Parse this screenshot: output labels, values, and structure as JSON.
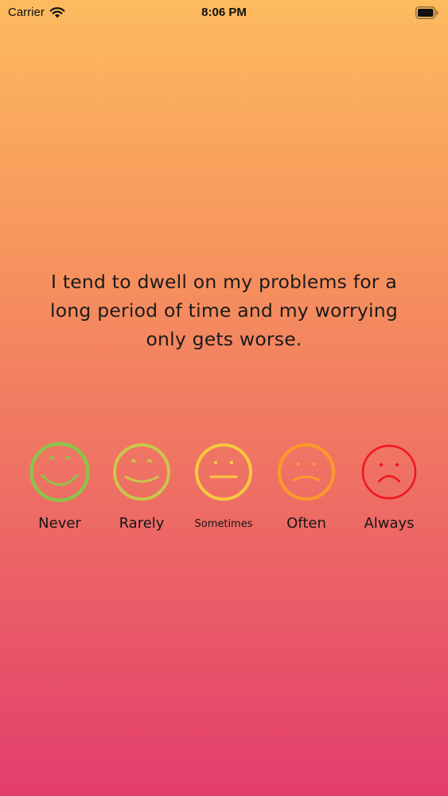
{
  "status_bar": {
    "carrier": "Carrier",
    "time": "8:06 PM",
    "wifi_icon": "wifi-icon",
    "battery_icon": "battery-icon"
  },
  "question": {
    "text": "I tend to dwell on my problems for a long period of time and my worrying only gets worse."
  },
  "options": [
    {
      "label": "Never",
      "icon": "big-smile-face-icon",
      "color": "#8cc34a"
    },
    {
      "label": "Rarely",
      "icon": "smile-face-icon",
      "color": "#c9c64a"
    },
    {
      "label": "Sometimes",
      "icon": "neutral-face-icon",
      "color": "#f7c93e"
    },
    {
      "label": "Often",
      "icon": "slight-frown-face-icon",
      "color": "#fb9a2a"
    },
    {
      "label": "Always",
      "icon": "frown-face-icon",
      "color": "#f0141e"
    }
  ],
  "colors": {
    "gradient_top": "#fdbb5e",
    "gradient_bottom": "#e33d6d"
  }
}
